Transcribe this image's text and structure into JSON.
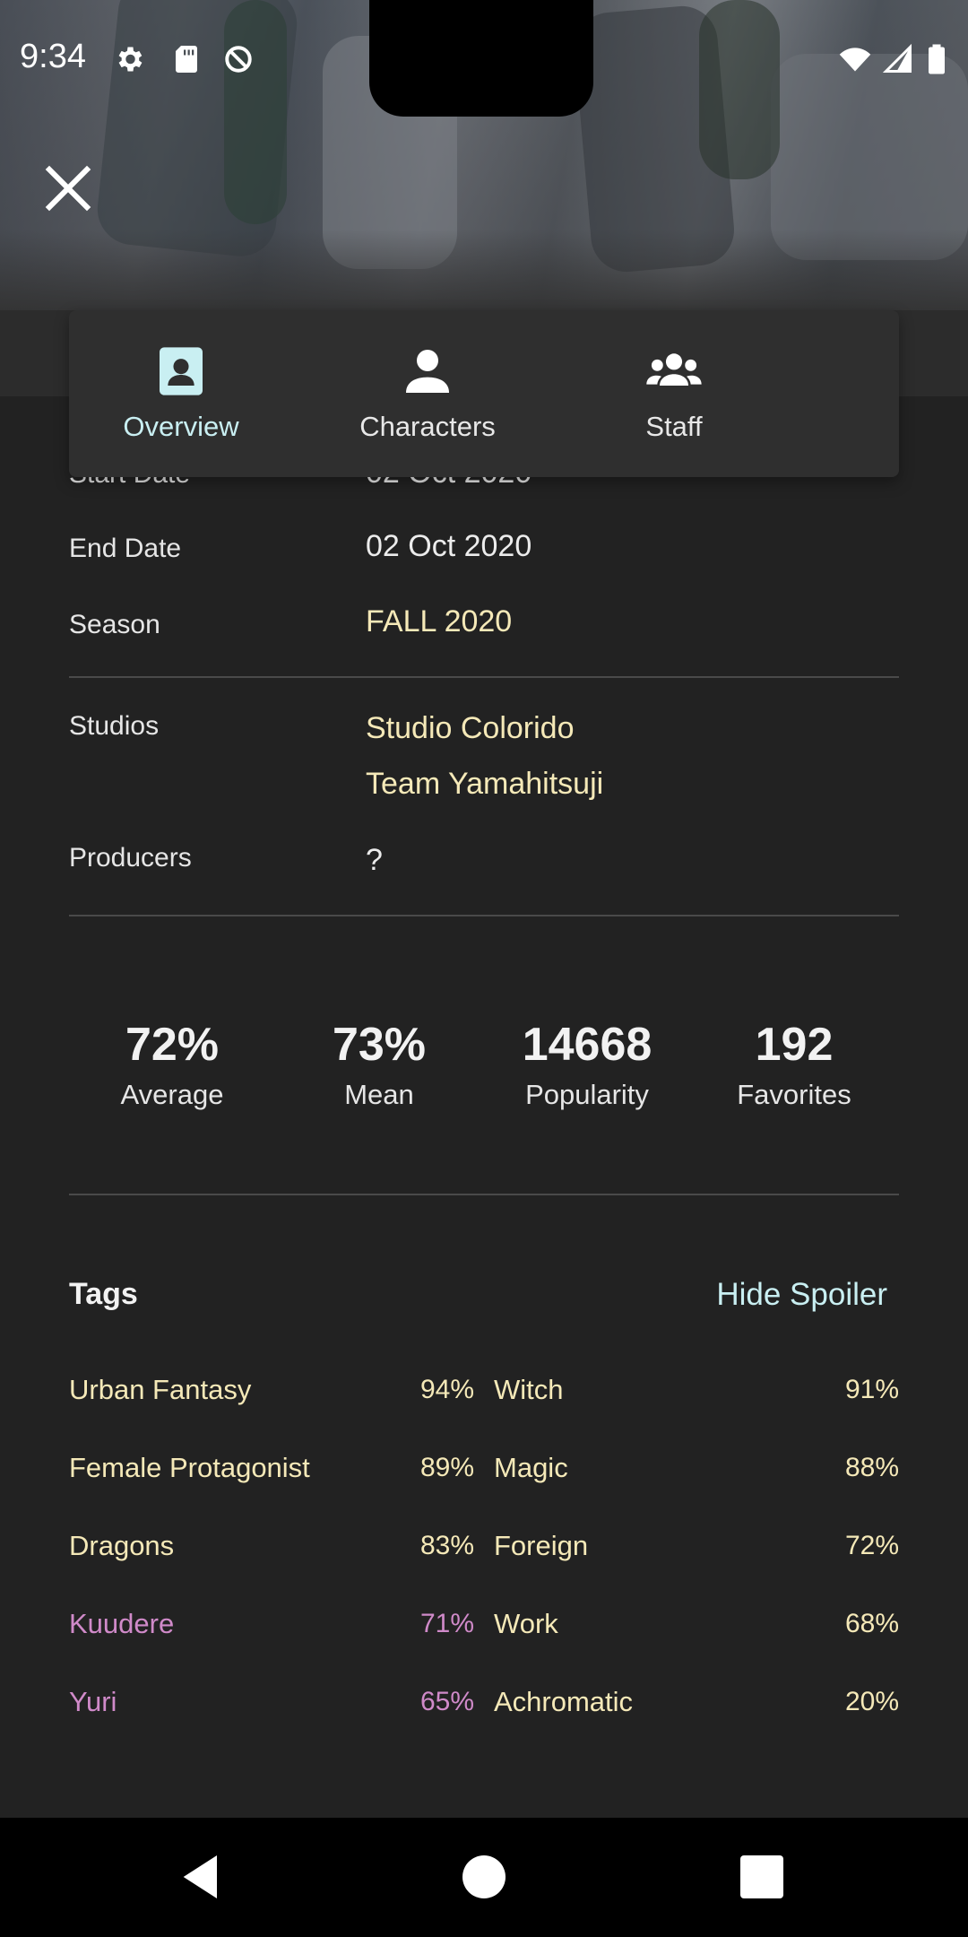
{
  "status_bar": {
    "time": "9:34",
    "left_icons": [
      "settings-icon",
      "sd-card-icon",
      "data-saver-icon"
    ],
    "right_icons": [
      "wifi-icon",
      "signal-icon",
      "battery-icon"
    ]
  },
  "header": {
    "close_icon": "close-icon"
  },
  "tabs": [
    {
      "label": "Overview",
      "icon": "contact-card-icon",
      "active": true
    },
    {
      "label": "Characters",
      "icon": "person-icon",
      "active": false
    },
    {
      "label": "Staff",
      "icon": "group-icon",
      "active": false
    }
  ],
  "details": {
    "start_date": {
      "label": "Start Date",
      "value": "02 Oct 2020"
    },
    "end_date": {
      "label": "End Date",
      "value": "02 Oct 2020"
    },
    "season": {
      "label": "Season",
      "value": "FALL 2020"
    },
    "studios": {
      "label": "Studios",
      "values": [
        "Studio Colorido",
        "Team Yamahitsuji"
      ]
    },
    "producers": {
      "label": "Producers",
      "value": "?"
    }
  },
  "stats": [
    {
      "value": "72%",
      "label": "Average"
    },
    {
      "value": "73%",
      "label": "Mean"
    },
    {
      "value": "14668",
      "label": "Popularity"
    },
    {
      "value": "192",
      "label": "Favorites"
    }
  ],
  "tags": {
    "title": "Tags",
    "hide_spoiler_label": "Hide Spoiler",
    "items": [
      {
        "name": "Urban Fantasy",
        "percent": "94%",
        "spoiler": false
      },
      {
        "name": "Witch",
        "percent": "91%",
        "spoiler": false
      },
      {
        "name": "Female Protagonist",
        "percent": "89%",
        "spoiler": false
      },
      {
        "name": "Magic",
        "percent": "88%",
        "spoiler": false
      },
      {
        "name": "Dragons",
        "percent": "83%",
        "spoiler": false
      },
      {
        "name": "Foreign",
        "percent": "72%",
        "spoiler": false
      },
      {
        "name": "Kuudere",
        "percent": "71%",
        "spoiler": true
      },
      {
        "name": "Work",
        "percent": "68%",
        "spoiler": false
      },
      {
        "name": "Yuri",
        "percent": "65%",
        "spoiler": true
      },
      {
        "name": "Achromatic",
        "percent": "20%",
        "spoiler": false
      }
    ]
  },
  "nav_bar": {
    "buttons": [
      "back-icon",
      "home-icon",
      "recents-icon"
    ]
  },
  "colors": {
    "background": "#222222",
    "accent_link": "#f5e9b8",
    "accent_active": "#c9eff2",
    "spoiler": "#d08ac9"
  }
}
